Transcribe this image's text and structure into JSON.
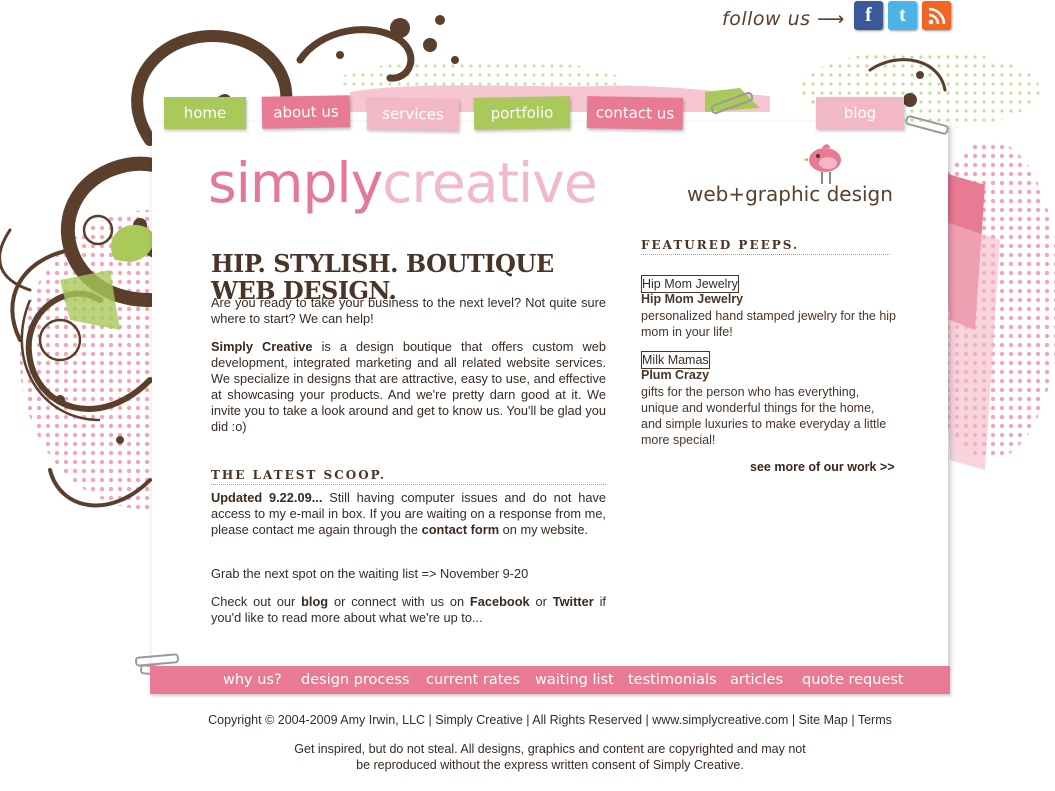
{
  "header": {
    "follow_label": "follow us",
    "social": [
      {
        "name": "Facebook",
        "glyph": "f",
        "color": "#3b5998"
      },
      {
        "name": "Twitter",
        "glyph": "t",
        "color": "#4ab3e8"
      },
      {
        "name": "RSS",
        "glyph": "rss",
        "color": "#f26522"
      }
    ]
  },
  "nav": {
    "home": "home",
    "about": "about us",
    "services": "services",
    "portfolio": "portfolio",
    "contact": "contact us",
    "blog": "blog"
  },
  "brand": {
    "logo_part1": "simply",
    "logo_part2": "creative",
    "tagline": "web+graphic design"
  },
  "main": {
    "headline": "HIP. STYLISH. BOUTIQUE WEB DESIGN.",
    "intro1": "Are you ready to take your business to the next level? Not quite sure where to start? We can help!",
    "intro2_bold": "Simply Creative",
    "intro2_rest": " is a design boutique that offers custom web development, integrated marketing and all related website services. We specialize in designs that are attractive, easy to use, and effective at showcasing your products. And we're pretty darn good at it. We invite you to take a look around and get to know us. You'll be glad you did :o)",
    "scoop_heading": "THE LATEST SCOOP.",
    "scoop1_bold": "Updated 9.22.09...",
    "scoop1_rest": " Still having computer issues and do not have access to my e-mail in box. If you are waiting on a response from me, please contact me again through the ",
    "scoop1_link": "contact form",
    "scoop1_end": " on my website.",
    "scoop2": "Grab the next spot on the waiting list => November 9-20",
    "scoop3_a": "Check out our ",
    "scoop3_blog": "blog",
    "scoop3_b": " or connect with us on ",
    "scoop3_fb": "Facebook",
    "scoop3_c": " or ",
    "scoop3_tw": "Twitter",
    "scoop3_d": " if you'd like to read more about what we're up to..."
  },
  "featured": {
    "heading": "FEATURED PEEPS.",
    "items": [
      {
        "thumb_alt": "Hip Mom Jewelry",
        "title": "Hip Mom Jewelry",
        "desc": "personalized hand stamped jewelry for the hip mom in your life!"
      },
      {
        "thumb_alt": "Milk Mamas",
        "title": "Plum Crazy",
        "desc": "gifts for the person who has everything, unique and wonderful things for the home, and simple luxuries to make everyday a little more special!"
      }
    ],
    "see_more": "see more of our work >>"
  },
  "bottom_nav": [
    "why us?",
    "design process",
    "current rates",
    "waiting list",
    "testimonials",
    "articles",
    "quote request"
  ],
  "footer": {
    "line1": "Copyright © 2004-2009 Amy Irwin, LLC  |  Simply Creative  |  All Rights Reserved  |  www.simplycreative.com  |  Site Map  |  Terms",
    "line2a": "Get inspired, but do not steal. All designs, graphics and content are copyrighted and may not",
    "line2b": "be reproduced without the express written consent of Simply Creative."
  },
  "colors": {
    "pink": "#e97a93",
    "light_pink": "#f3b8c6",
    "green": "#a9c95a",
    "brown": "#4a3426"
  }
}
